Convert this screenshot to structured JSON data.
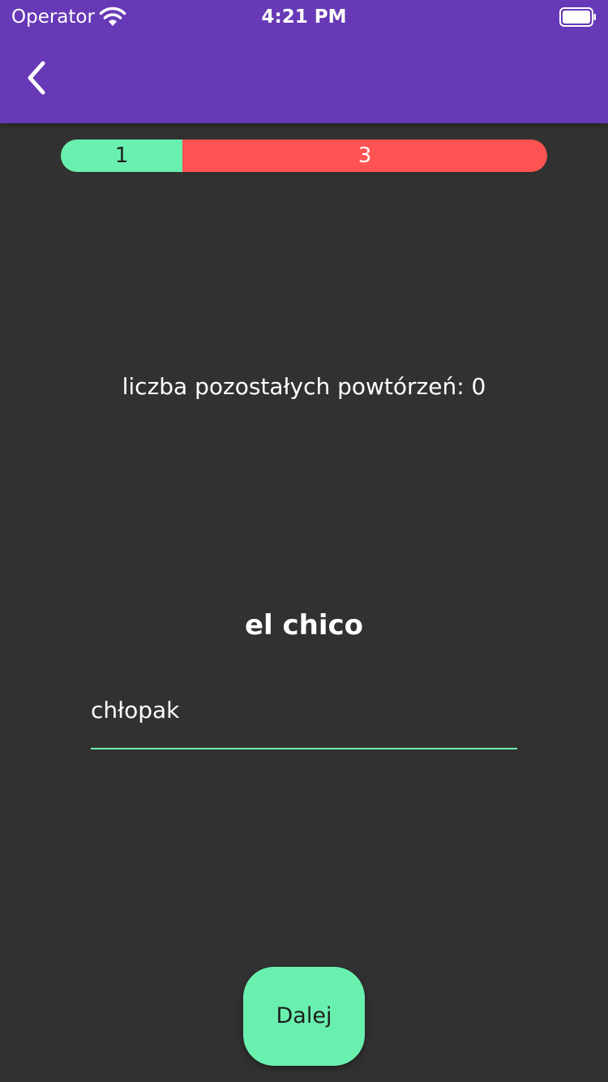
{
  "colors": {
    "accent": "#6739b6",
    "background": "#313131",
    "correct": "#69f0ae",
    "incorrect": "#ff5252"
  },
  "status_bar": {
    "carrier": "Operator",
    "time": "4:21 PM",
    "icons": [
      "wifi-icon",
      "battery-icon"
    ]
  },
  "app_bar": {
    "back_icon": "chevron-left-icon"
  },
  "progress": {
    "correct_count": "1",
    "incorrect_count": "3",
    "correct_fraction": 0.25
  },
  "quiz": {
    "remaining_label": "liczba pozostałych powtórzeń: 0",
    "word": "el chico",
    "answer_value": "chłopak",
    "next_label": "Dalej"
  }
}
